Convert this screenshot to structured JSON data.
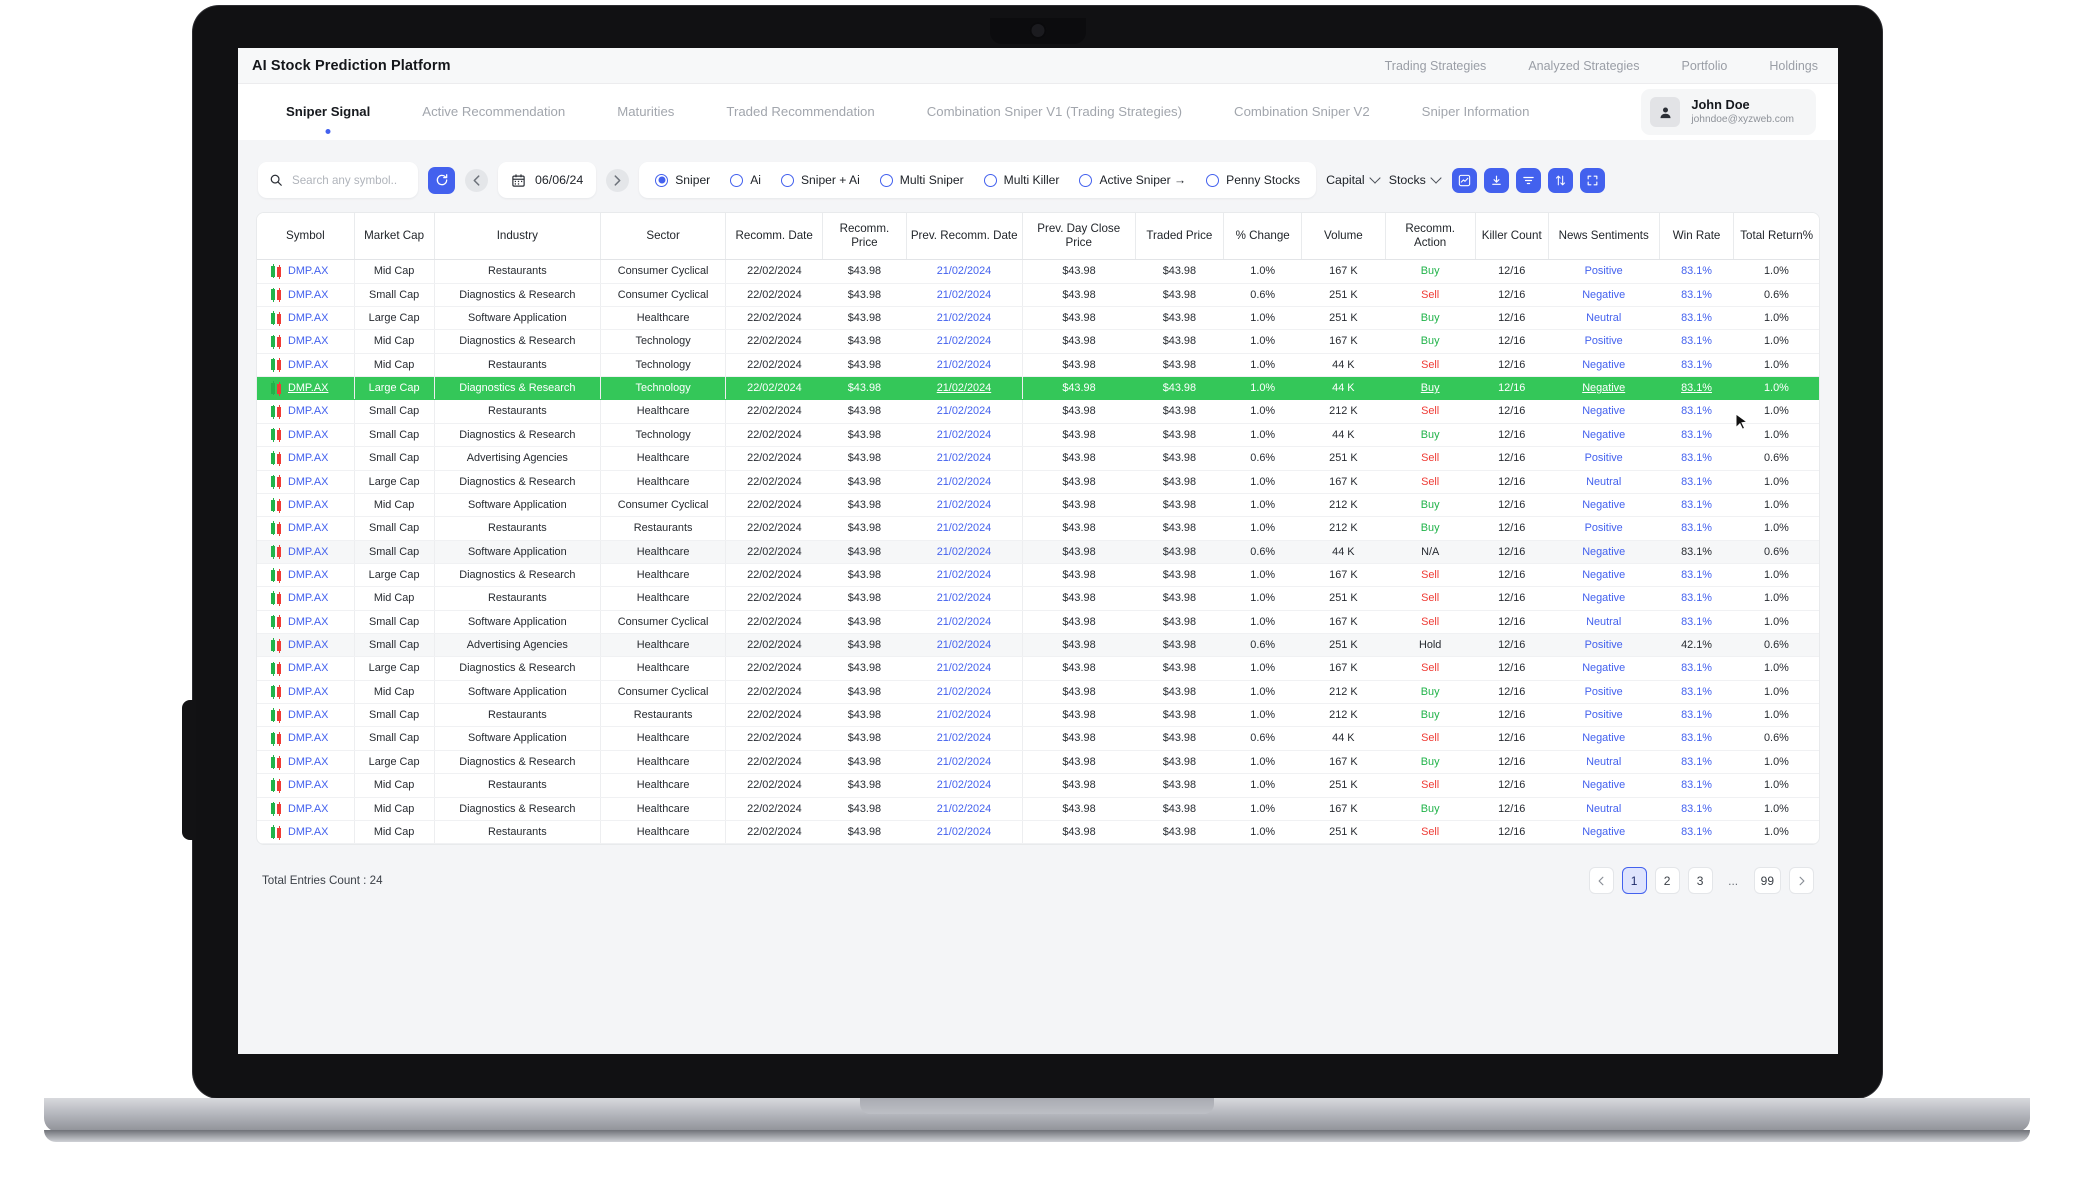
{
  "header": {
    "title": "AI Stock Prediction Platform",
    "links": [
      "Trading Strategies",
      "Analyzed Strategies",
      "Portfolio",
      "Holdings"
    ]
  },
  "tabs": [
    {
      "label": "Sniper Signal",
      "active": true
    },
    {
      "label": "Active Recommendation",
      "active": false
    },
    {
      "label": "Maturities",
      "active": false
    },
    {
      "label": "Traded Recommendation",
      "active": false
    },
    {
      "label": "Combination Sniper V1 (Trading Strategies)",
      "active": false
    },
    {
      "label": "Combination Sniper V2",
      "active": false
    },
    {
      "label": "Sniper Information",
      "active": false
    }
  ],
  "profile": {
    "name": "John Doe",
    "email": "johndoe@xyzweb.com",
    "avatar_icon": "user-icon"
  },
  "toolbar": {
    "search_placeholder": "Search any symbol..",
    "search_value": "",
    "search_icon": "search-icon",
    "refresh_icon": "refresh-icon",
    "prev_icon": "chevron-left-icon",
    "next_icon": "chevron-right-icon",
    "calendar_icon": "calendar-icon",
    "date": "06/06/24",
    "radios": [
      {
        "label": "Sniper",
        "checked": true
      },
      {
        "label": "Ai",
        "checked": false
      },
      {
        "label": "Sniper + Ai",
        "checked": false
      },
      {
        "label": "Multi Sniper",
        "checked": false
      },
      {
        "label": "Multi Killer",
        "checked": false
      },
      {
        "label": "Active Sniper →",
        "checked": false
      },
      {
        "label": "Penny Stocks",
        "checked": false
      }
    ],
    "dropdowns": [
      {
        "label": "Capital",
        "icon": "chevron-down-icon"
      },
      {
        "label": "Stocks",
        "icon": "chevron-down-icon"
      }
    ],
    "action_icons": [
      "chart-icon",
      "download-icon",
      "filter-icon",
      "sort-icon",
      "fullscreen-icon"
    ],
    "accent_color": "#4361ee"
  },
  "table": {
    "columns": [
      "Symbol",
      "Market Cap",
      "Industry",
      "Sector",
      "Recomm. Date",
      "Recomm. Price",
      "Prev. Recomm. Date",
      "Prev. Day Close Price",
      "Traded Price",
      "% Change",
      "Volume",
      "Recomm. Action",
      "Killer Count",
      "News Sentiments",
      "Win Rate",
      "Total Return%"
    ],
    "rows": [
      {
        "symbol": "DMP.AX",
        "market_cap": "Mid Cap",
        "industry": "Restaurants",
        "sector": "Consumer Cyclical",
        "recomm_date": "22/02/2024",
        "recomm_price": "$43.98",
        "prev_recomm_date": "21/02/2024",
        "prev_close": "$43.98",
        "traded_price": "$43.98",
        "change": "1.0%",
        "volume": "167 K",
        "action": "Buy",
        "killer_count": "12/16",
        "sentiment": "Positive",
        "win_rate": "83.1%",
        "total_return": "1.0%",
        "style": "normal"
      },
      {
        "symbol": "DMP.AX",
        "market_cap": "Small Cap",
        "industry": "Diagnostics & Research",
        "sector": "Consumer Cyclical",
        "recomm_date": "22/02/2024",
        "recomm_price": "$43.98",
        "prev_recomm_date": "21/02/2024",
        "prev_close": "$43.98",
        "traded_price": "$43.98",
        "change": "0.6%",
        "volume": "251 K",
        "action": "Sell",
        "killer_count": "12/16",
        "sentiment": "Negative",
        "win_rate": "83.1%",
        "total_return": "0.6%",
        "style": "normal"
      },
      {
        "symbol": "DMP.AX",
        "market_cap": "Large Cap",
        "industry": "Software Application",
        "sector": "Healthcare",
        "recomm_date": "22/02/2024",
        "recomm_price": "$43.98",
        "prev_recomm_date": "21/02/2024",
        "prev_close": "$43.98",
        "traded_price": "$43.98",
        "change": "1.0%",
        "volume": "251 K",
        "action": "Buy",
        "killer_count": "12/16",
        "sentiment": "Neutral",
        "win_rate": "83.1%",
        "total_return": "1.0%",
        "style": "normal"
      },
      {
        "symbol": "DMP.AX",
        "market_cap": "Mid Cap",
        "industry": "Diagnostics & Research",
        "sector": "Technology",
        "recomm_date": "22/02/2024",
        "recomm_price": "$43.98",
        "prev_recomm_date": "21/02/2024",
        "prev_close": "$43.98",
        "traded_price": "$43.98",
        "change": "1.0%",
        "volume": "167 K",
        "action": "Buy",
        "killer_count": "12/16",
        "sentiment": "Positive",
        "win_rate": "83.1%",
        "total_return": "1.0%",
        "style": "normal"
      },
      {
        "symbol": "DMP.AX",
        "market_cap": "Mid Cap",
        "industry": "Restaurants",
        "sector": "Technology",
        "recomm_date": "22/02/2024",
        "recomm_price": "$43.98",
        "prev_recomm_date": "21/02/2024",
        "prev_close": "$43.98",
        "traded_price": "$43.98",
        "change": "1.0%",
        "volume": "44 K",
        "action": "Sell",
        "killer_count": "12/16",
        "sentiment": "Negative",
        "win_rate": "83.1%",
        "total_return": "1.0%",
        "style": "normal"
      },
      {
        "symbol": "DMP.AX",
        "market_cap": "Large Cap",
        "industry": "Diagnostics & Research",
        "sector": "Technology",
        "recomm_date": "22/02/2024",
        "recomm_price": "$43.98",
        "prev_recomm_date": "21/02/2024",
        "prev_close": "$43.98",
        "traded_price": "$43.98",
        "change": "1.0%",
        "volume": "44 K",
        "action": "Buy",
        "killer_count": "12/16",
        "sentiment": "Negative",
        "win_rate": "83.1%",
        "total_return": "1.0%",
        "style": "selected"
      },
      {
        "symbol": "DMP.AX",
        "market_cap": "Small Cap",
        "industry": "Restaurants",
        "sector": "Healthcare",
        "recomm_date": "22/02/2024",
        "recomm_price": "$43.98",
        "prev_recomm_date": "21/02/2024",
        "prev_close": "$43.98",
        "traded_price": "$43.98",
        "change": "1.0%",
        "volume": "212 K",
        "action": "Sell",
        "killer_count": "12/16",
        "sentiment": "Negative",
        "win_rate": "83.1%",
        "total_return": "1.0%",
        "style": "normal"
      },
      {
        "symbol": "DMP.AX",
        "market_cap": "Small Cap",
        "industry": "Diagnostics & Research",
        "sector": "Technology",
        "recomm_date": "22/02/2024",
        "recomm_price": "$43.98",
        "prev_recomm_date": "21/02/2024",
        "prev_close": "$43.98",
        "traded_price": "$43.98",
        "change": "1.0%",
        "volume": "44 K",
        "action": "Buy",
        "killer_count": "12/16",
        "sentiment": "Negative",
        "win_rate": "83.1%",
        "total_return": "1.0%",
        "style": "normal"
      },
      {
        "symbol": "DMP.AX",
        "market_cap": "Small Cap",
        "industry": "Advertising Agencies",
        "sector": "Healthcare",
        "recomm_date": "22/02/2024",
        "recomm_price": "$43.98",
        "prev_recomm_date": "21/02/2024",
        "prev_close": "$43.98",
        "traded_price": "$43.98",
        "change": "0.6%",
        "volume": "251 K",
        "action": "Sell",
        "killer_count": "12/16",
        "sentiment": "Positive",
        "win_rate": "83.1%",
        "total_return": "0.6%",
        "style": "normal"
      },
      {
        "symbol": "DMP.AX",
        "market_cap": "Large Cap",
        "industry": "Diagnostics & Research",
        "sector": "Healthcare",
        "recomm_date": "22/02/2024",
        "recomm_price": "$43.98",
        "prev_recomm_date": "21/02/2024",
        "prev_close": "$43.98",
        "traded_price": "$43.98",
        "change": "1.0%",
        "volume": "167 K",
        "action": "Sell",
        "killer_count": "12/16",
        "sentiment": "Neutral",
        "win_rate": "83.1%",
        "total_return": "1.0%",
        "style": "normal"
      },
      {
        "symbol": "DMP.AX",
        "market_cap": "Mid Cap",
        "industry": "Software Application",
        "sector": "Consumer Cyclical",
        "recomm_date": "22/02/2024",
        "recomm_price": "$43.98",
        "prev_recomm_date": "21/02/2024",
        "prev_close": "$43.98",
        "traded_price": "$43.98",
        "change": "1.0%",
        "volume": "212 K",
        "action": "Buy",
        "killer_count": "12/16",
        "sentiment": "Negative",
        "win_rate": "83.1%",
        "total_return": "1.0%",
        "style": "normal"
      },
      {
        "symbol": "DMP.AX",
        "market_cap": "Small Cap",
        "industry": "Restaurants",
        "sector": "Restaurants",
        "recomm_date": "22/02/2024",
        "recomm_price": "$43.98",
        "prev_recomm_date": "21/02/2024",
        "prev_close": "$43.98",
        "traded_price": "$43.98",
        "change": "1.0%",
        "volume": "212 K",
        "action": "Buy",
        "killer_count": "12/16",
        "sentiment": "Positive",
        "win_rate": "83.1%",
        "total_return": "1.0%",
        "style": "normal"
      },
      {
        "symbol": "DMP.AX",
        "market_cap": "Small Cap",
        "industry": "Software Application",
        "sector": "Healthcare",
        "recomm_date": "22/02/2024",
        "recomm_price": "$43.98",
        "prev_recomm_date": "21/02/2024",
        "prev_close": "$43.98",
        "traded_price": "$43.98",
        "change": "0.6%",
        "volume": "44 K",
        "action": "N/A",
        "killer_count": "12/16",
        "sentiment": "Negative",
        "win_rate": "83.1%",
        "total_return": "0.6%",
        "style": "alt"
      },
      {
        "symbol": "DMP.AX",
        "market_cap": "Large Cap",
        "industry": "Diagnostics & Research",
        "sector": "Healthcare",
        "recomm_date": "22/02/2024",
        "recomm_price": "$43.98",
        "prev_recomm_date": "21/02/2024",
        "prev_close": "$43.98",
        "traded_price": "$43.98",
        "change": "1.0%",
        "volume": "167 K",
        "action": "Sell",
        "killer_count": "12/16",
        "sentiment": "Negative",
        "win_rate": "83.1%",
        "total_return": "1.0%",
        "style": "normal"
      },
      {
        "symbol": "DMP.AX",
        "market_cap": "Mid Cap",
        "industry": "Restaurants",
        "sector": "Healthcare",
        "recomm_date": "22/02/2024",
        "recomm_price": "$43.98",
        "prev_recomm_date": "21/02/2024",
        "prev_close": "$43.98",
        "traded_price": "$43.98",
        "change": "1.0%",
        "volume": "251 K",
        "action": "Sell",
        "killer_count": "12/16",
        "sentiment": "Negative",
        "win_rate": "83.1%",
        "total_return": "1.0%",
        "style": "normal"
      },
      {
        "symbol": "DMP.AX",
        "market_cap": "Small Cap",
        "industry": "Software Application",
        "sector": "Consumer Cyclical",
        "recomm_date": "22/02/2024",
        "recomm_price": "$43.98",
        "prev_recomm_date": "21/02/2024",
        "prev_close": "$43.98",
        "traded_price": "$43.98",
        "change": "1.0%",
        "volume": "167 K",
        "action": "Sell",
        "killer_count": "12/16",
        "sentiment": "Neutral",
        "win_rate": "83.1%",
        "total_return": "1.0%",
        "style": "normal"
      },
      {
        "symbol": "DMP.AX",
        "market_cap": "Small Cap",
        "industry": "Advertising Agencies",
        "sector": "Healthcare",
        "recomm_date": "22/02/2024",
        "recomm_price": "$43.98",
        "prev_recomm_date": "21/02/2024",
        "prev_close": "$43.98",
        "traded_price": "$43.98",
        "change": "0.6%",
        "volume": "251 K",
        "action": "Hold",
        "killer_count": "12/16",
        "sentiment": "Positive",
        "win_rate": "42.1%",
        "total_return": "0.6%",
        "style": "alt"
      },
      {
        "symbol": "DMP.AX",
        "market_cap": "Large Cap",
        "industry": "Diagnostics & Research",
        "sector": "Healthcare",
        "recomm_date": "22/02/2024",
        "recomm_price": "$43.98",
        "prev_recomm_date": "21/02/2024",
        "prev_close": "$43.98",
        "traded_price": "$43.98",
        "change": "1.0%",
        "volume": "167 K",
        "action": "Sell",
        "killer_count": "12/16",
        "sentiment": "Negative",
        "win_rate": "83.1%",
        "total_return": "1.0%",
        "style": "normal"
      },
      {
        "symbol": "DMP.AX",
        "market_cap": "Mid Cap",
        "industry": "Software Application",
        "sector": "Consumer Cyclical",
        "recomm_date": "22/02/2024",
        "recomm_price": "$43.98",
        "prev_recomm_date": "21/02/2024",
        "prev_close": "$43.98",
        "traded_price": "$43.98",
        "change": "1.0%",
        "volume": "212 K",
        "action": "Buy",
        "killer_count": "12/16",
        "sentiment": "Positive",
        "win_rate": "83.1%",
        "total_return": "1.0%",
        "style": "normal"
      },
      {
        "symbol": "DMP.AX",
        "market_cap": "Small Cap",
        "industry": "Restaurants",
        "sector": "Restaurants",
        "recomm_date": "22/02/2024",
        "recomm_price": "$43.98",
        "prev_recomm_date": "21/02/2024",
        "prev_close": "$43.98",
        "traded_price": "$43.98",
        "change": "1.0%",
        "volume": "212 K",
        "action": "Buy",
        "killer_count": "12/16",
        "sentiment": "Positive",
        "win_rate": "83.1%",
        "total_return": "1.0%",
        "style": "normal"
      },
      {
        "symbol": "DMP.AX",
        "market_cap": "Small Cap",
        "industry": "Software Application",
        "sector": "Healthcare",
        "recomm_date": "22/02/2024",
        "recomm_price": "$43.98",
        "prev_recomm_date": "21/02/2024",
        "prev_close": "$43.98",
        "traded_price": "$43.98",
        "change": "0.6%",
        "volume": "44 K",
        "action": "Sell",
        "killer_count": "12/16",
        "sentiment": "Negative",
        "win_rate": "83.1%",
        "total_return": "0.6%",
        "style": "normal"
      },
      {
        "symbol": "DMP.AX",
        "market_cap": "Large Cap",
        "industry": "Diagnostics & Research",
        "sector": "Healthcare",
        "recomm_date": "22/02/2024",
        "recomm_price": "$43.98",
        "prev_recomm_date": "21/02/2024",
        "prev_close": "$43.98",
        "traded_price": "$43.98",
        "change": "1.0%",
        "volume": "167 K",
        "action": "Buy",
        "killer_count": "12/16",
        "sentiment": "Neutral",
        "win_rate": "83.1%",
        "total_return": "1.0%",
        "style": "normal"
      },
      {
        "symbol": "DMP.AX",
        "market_cap": "Mid Cap",
        "industry": "Restaurants",
        "sector": "Healthcare",
        "recomm_date": "22/02/2024",
        "recomm_price": "$43.98",
        "prev_recomm_date": "21/02/2024",
        "prev_close": "$43.98",
        "traded_price": "$43.98",
        "change": "1.0%",
        "volume": "251 K",
        "action": "Sell",
        "killer_count": "12/16",
        "sentiment": "Negative",
        "win_rate": "83.1%",
        "total_return": "1.0%",
        "style": "normal"
      },
      {
        "symbol": "DMP.AX",
        "market_cap": "Mid Cap",
        "industry": "Diagnostics & Research",
        "sector": "Healthcare",
        "recomm_date": "22/02/2024",
        "recomm_price": "$43.98",
        "prev_recomm_date": "21/02/2024",
        "prev_close": "$43.98",
        "traded_price": "$43.98",
        "change": "1.0%",
        "volume": "167 K",
        "action": "Buy",
        "killer_count": "12/16",
        "sentiment": "Neutral",
        "win_rate": "83.1%",
        "total_return": "1.0%",
        "style": "normal"
      },
      {
        "symbol": "DMP.AX",
        "market_cap": "Mid Cap",
        "industry": "Restaurants",
        "sector": "Healthcare",
        "recomm_date": "22/02/2024",
        "recomm_price": "$43.98",
        "prev_recomm_date": "21/02/2024",
        "prev_close": "$43.98",
        "traded_price": "$43.98",
        "change": "1.0%",
        "volume": "251 K",
        "action": "Sell",
        "killer_count": "12/16",
        "sentiment": "Negative",
        "win_rate": "83.1%",
        "total_return": "1.0%",
        "style": "normal"
      }
    ]
  },
  "footer": {
    "entries_label": "Total Entries Count : 24",
    "pages": [
      "1",
      "2",
      "3",
      "...",
      "99"
    ],
    "active_page": "1",
    "prev_icon": "chevron-left-icon",
    "next_icon": "chevron-right-icon"
  },
  "colors": {
    "accent": "#4361ee",
    "buy": "#21b34a",
    "sell": "#ef3b35",
    "selected_row": "#34c759",
    "link": "#4361ee"
  }
}
